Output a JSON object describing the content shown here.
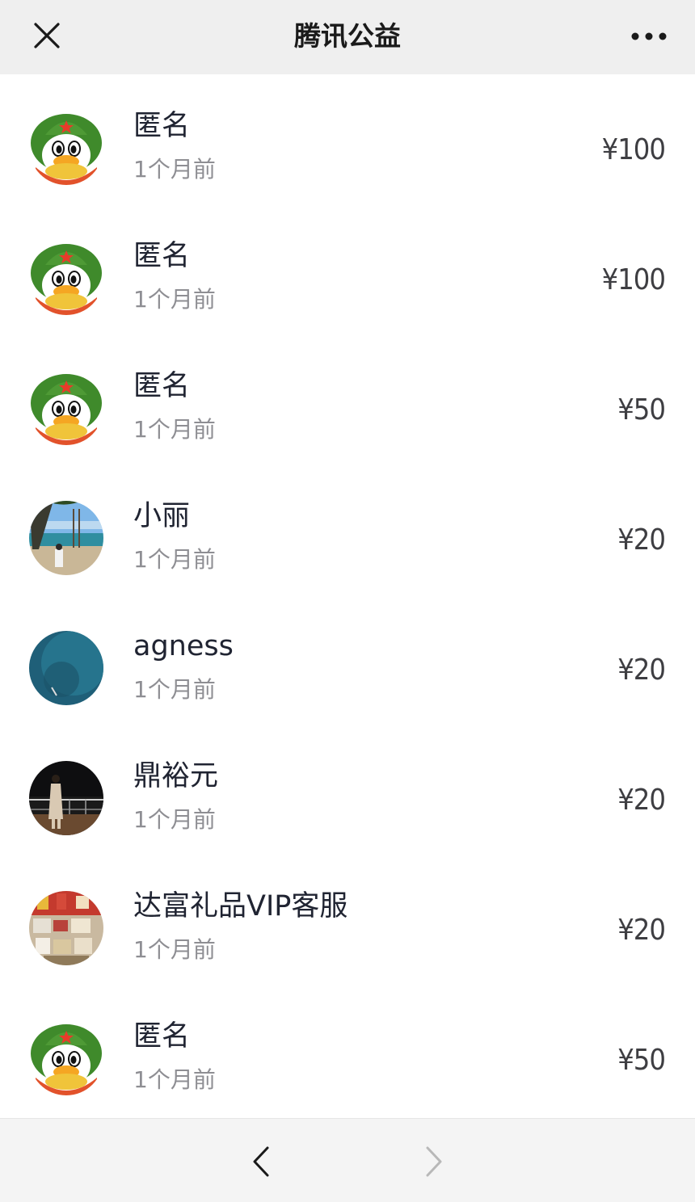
{
  "header": {
    "title": "腾讯公益",
    "close_icon": "close-icon",
    "more_icon": "more-horizontal-icon"
  },
  "colors": {
    "header_bg": "#efefef",
    "footer_bg": "#f4f4f4",
    "name": "#202432",
    "time": "#8e8e93",
    "amount": "#3e3e42"
  },
  "donations": [
    {
      "name": "匿名",
      "time": "1个月前",
      "amount": "¥100",
      "avatar": "qq-penguin-avatar"
    },
    {
      "name": "匿名",
      "time": "1个月前",
      "amount": "¥100",
      "avatar": "qq-penguin-avatar"
    },
    {
      "name": "匿名",
      "time": "1个月前",
      "amount": "¥50",
      "avatar": "qq-penguin-avatar"
    },
    {
      "name": "小丽",
      "time": "1个月前",
      "amount": "¥20",
      "avatar": "beach-photo-avatar"
    },
    {
      "name": "agness",
      "time": "1个月前",
      "amount": "¥20",
      "avatar": "blue-water-photo-avatar"
    },
    {
      "name": "鼎裕元",
      "time": "1个月前",
      "amount": "¥20",
      "avatar": "night-portrait-avatar"
    },
    {
      "name": "达富礼品VIP客服",
      "time": "1个月前",
      "amount": "¥20",
      "avatar": "gift-display-avatar"
    },
    {
      "name": "匿名",
      "time": "1个月前",
      "amount": "¥50",
      "avatar": "qq-penguin-avatar"
    }
  ],
  "footer": {
    "back_icon": "chevron-left-icon",
    "forward_icon": "chevron-right-icon"
  }
}
